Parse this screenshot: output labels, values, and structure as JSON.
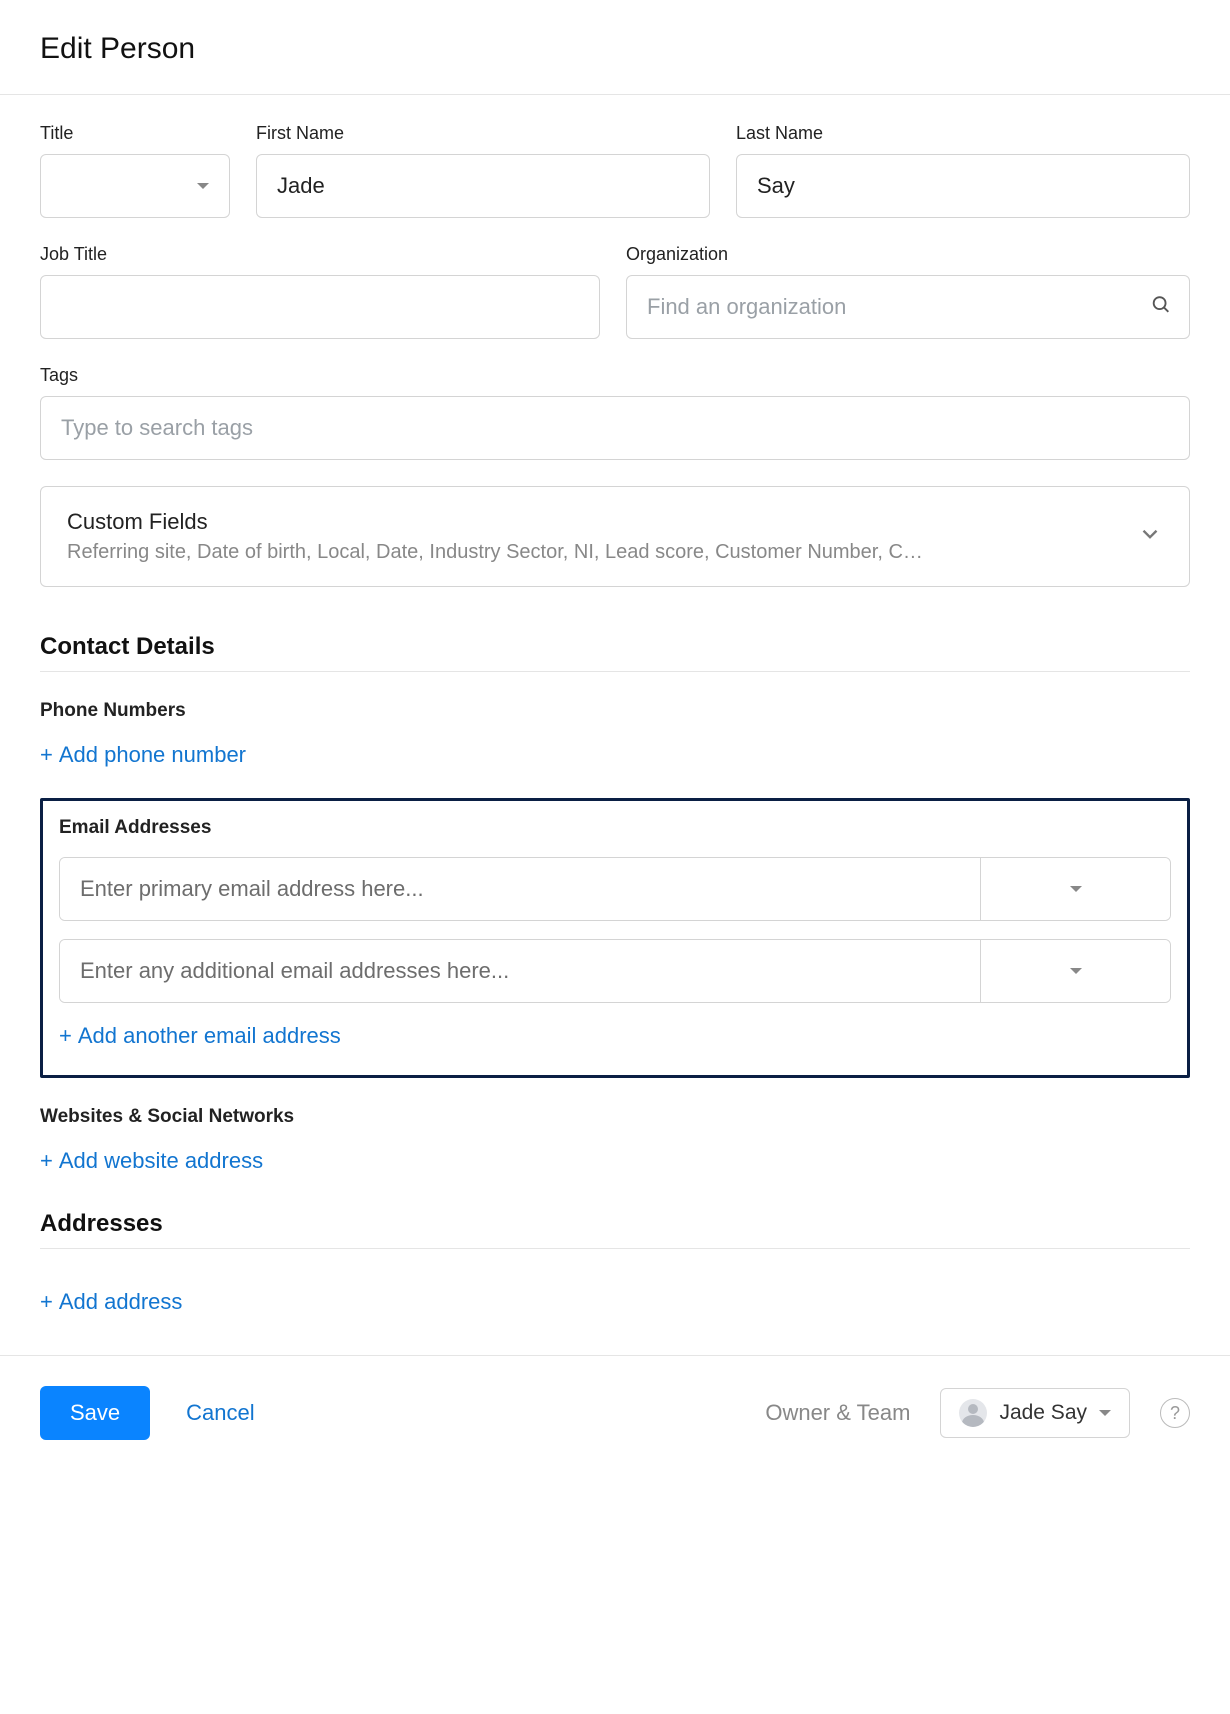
{
  "header": {
    "title": "Edit Person"
  },
  "fields": {
    "title": {
      "label": "Title",
      "value": ""
    },
    "first_name": {
      "label": "First Name",
      "value": "Jade"
    },
    "last_name": {
      "label": "Last Name",
      "value": "Say"
    },
    "job_title": {
      "label": "Job Title",
      "value": ""
    },
    "organization": {
      "label": "Organization",
      "placeholder": "Find an organization",
      "value": ""
    },
    "tags": {
      "label": "Tags",
      "placeholder": "Type to search tags",
      "value": ""
    }
  },
  "custom_fields": {
    "title": "Custom Fields",
    "summary": "Referring site, Date of birth, Local, Date, Industry Sector, NI, Lead score, Customer Number, C…"
  },
  "sections": {
    "contact_details": "Contact Details",
    "phone_numbers": "Phone Numbers",
    "add_phone": "Add phone number",
    "email_addresses": "Email Addresses",
    "email_primary_placeholder": "Enter primary email address here...",
    "email_additional_placeholder": "Enter any additional email addresses here...",
    "add_email": "Add another email address",
    "websites_social": "Websites & Social Networks",
    "add_website": "Add website address",
    "addresses": "Addresses",
    "add_address": "Add address"
  },
  "footer": {
    "save": "Save",
    "cancel": "Cancel",
    "owner_team_label": "Owner & Team",
    "owner_name": "Jade Say",
    "help": "?"
  }
}
